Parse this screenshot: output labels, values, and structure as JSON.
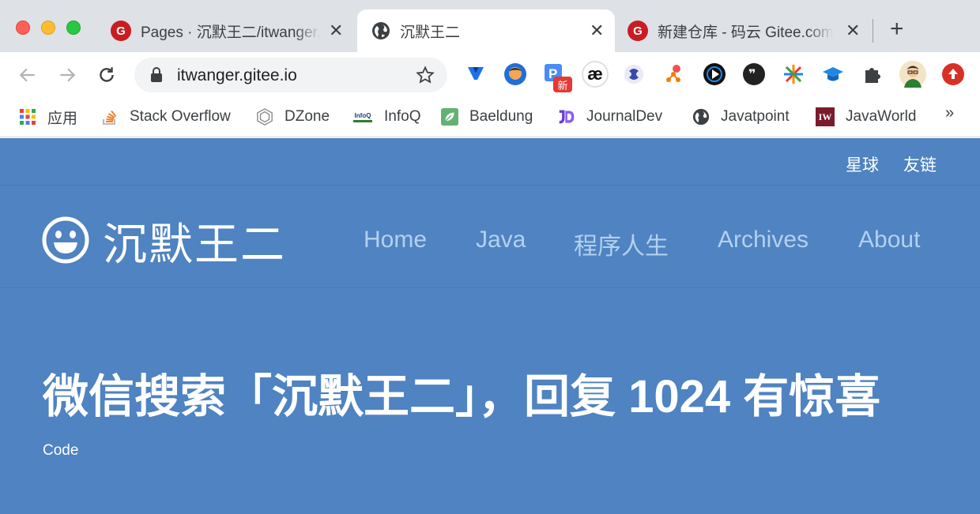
{
  "browser": {
    "tabs": [
      {
        "title": "Pages · 沉默王二/itwanger.gitee.io",
        "favicon": "gitee-icon",
        "close": "✕"
      },
      {
        "title": "沉默王二",
        "favicon": "globe-icon",
        "close": "✕"
      },
      {
        "title": "新建仓库 - 码云 Gitee.com",
        "favicon": "gitee-icon",
        "close": "✕"
      }
    ],
    "new_tab_label": "+",
    "url": "itwanger.gitee.io",
    "extension_badge": "新",
    "bookmarks": [
      {
        "label": "应用",
        "icon": "apps-grid-icon"
      },
      {
        "label": "Stack Overflow",
        "icon": "stackoverflow-icon"
      },
      {
        "label": "DZone",
        "icon": "dzone-icon"
      },
      {
        "label": "InfoQ",
        "icon": "infoq-icon"
      },
      {
        "label": "Baeldung",
        "icon": "baeldung-icon"
      },
      {
        "label": "JournalDev",
        "icon": "journaldev-icon"
      },
      {
        "label": "Javatpoint",
        "icon": "globe-icon"
      },
      {
        "label": "JavaWorld",
        "icon": "javaworld-icon"
      }
    ],
    "bookmarks_more": "»",
    "infoq_icon_text": "InfoQ",
    "javaworld_icon_text": "IW",
    "gitee_icon_text": "G"
  },
  "site": {
    "top_links": [
      "星球",
      "友链"
    ],
    "logo_text": "沉默王二",
    "nav": [
      "Home",
      "Java",
      "程序人生",
      "Archives",
      "About"
    ],
    "hero": "微信搜索「沉默王二」，回复 1024 有惊喜",
    "code_label": "Code"
  },
  "colors": {
    "page_bg": "#4f83c1",
    "nav_link": "#b3d0f0",
    "tabstrip_bg": "#dee1e6"
  }
}
